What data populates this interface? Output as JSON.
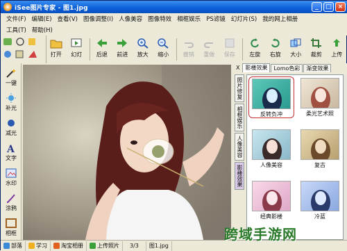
{
  "window": {
    "title": "iSee图片专家 - 图1.jpg",
    "min": "_",
    "max": "□",
    "close": "×"
  },
  "menu": {
    "row1": [
      "文件(F)",
      "编辑(E)",
      "查看(V)",
      "图像调整(I)",
      "人像美容",
      "图像特效",
      "相框娱乐",
      "PS滤镜",
      "幻灯片(S)",
      "我的网上相册"
    ],
    "row2": [
      "工具(T)",
      "帮助(H)"
    ]
  },
  "toolbar": {
    "open": "打开",
    "slideshow": "幻灯",
    "back": "后退",
    "forward": "前进",
    "zoom_in": "放大",
    "zoom_out": "缩小",
    "undo": "撤销",
    "redo": "重做",
    "save": "保存",
    "rotate_left": "左旋",
    "rotate_right": "右旋",
    "resize": "大小",
    "crop": "裁剪",
    "upload": "上传"
  },
  "sidebar": {
    "items": [
      "一键",
      "补光",
      "减光",
      "文字",
      "水印",
      "涂鸦",
      "相框"
    ]
  },
  "panel": {
    "close": "X",
    "tabs": [
      "影楼效果",
      "Lomo色彩",
      "渐变效果"
    ],
    "vtabs": [
      "照片修复",
      "相框娱乐",
      "人像美容",
      "影楼效果"
    ],
    "effects": [
      "反转负冲",
      "柔光艺术照",
      "人像美容",
      "复古",
      "经典影楼",
      "冷蓝"
    ]
  },
  "status": {
    "items": [
      "部落",
      "学习",
      "淘宝相册",
      "上传照片"
    ],
    "page": "3/3",
    "file": "图1.jpg"
  },
  "watermark": "跨域手游网",
  "colors": {
    "title_bar": "#0a5fd8",
    "selected_border": "#c03030",
    "accent_green": "#2a7a2a"
  }
}
